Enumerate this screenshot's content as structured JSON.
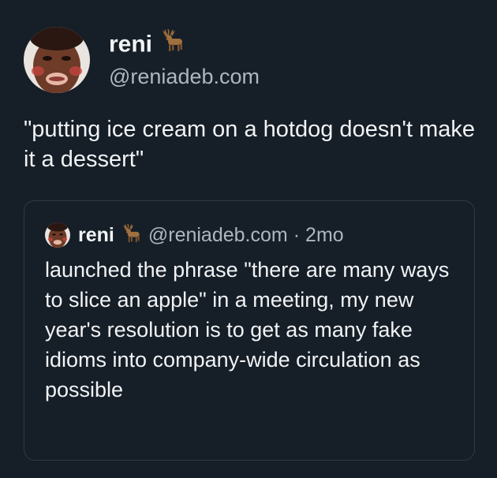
{
  "author": {
    "name": "reni",
    "handle": "@reniadeb.com",
    "name_emoji_icon": "deer-icon"
  },
  "post": {
    "text": "\"putting ice cream on a hotdog doesn't make it a dessert\""
  },
  "quoted_post": {
    "name": "reni",
    "name_emoji_icon": "deer-icon",
    "handle": "@reniadeb.com",
    "separator": "·",
    "time": "2mo",
    "text": "launched the phrase \"there are many ways to slice an apple\" in a meeting, my new year's resolution is to get as many fake idioms into company-wide circulation as possible"
  },
  "colors": {
    "background": "#161e27",
    "text": "#f1f3f5",
    "muted": "#aeb7c1",
    "border": "#2f3a46"
  }
}
